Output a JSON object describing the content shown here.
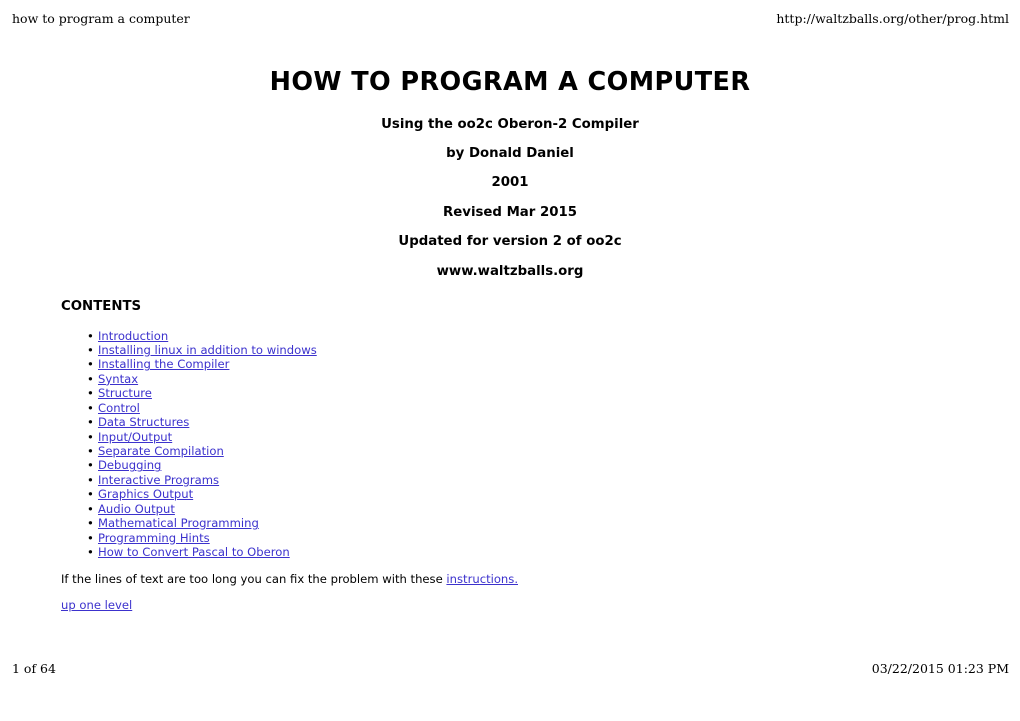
{
  "print_header": {
    "left": "how to program a computer",
    "right": "http://waltzballs.org/other/prog.html"
  },
  "print_footer": {
    "left": "1 of 64",
    "right": "03/22/2015 01:23 PM"
  },
  "document": {
    "title": "HOW TO PROGRAM A COMPUTER",
    "subtitles": [
      "Using the oo2c Oberon-2 Compiler",
      "by Donald Daniel",
      "2001",
      "Revised Mar 2015",
      "Updated for version 2 of oo2c",
      "www.waltzballs.org"
    ],
    "contents_heading": "CONTENTS",
    "toc": [
      "Introduction",
      "Installing linux in addition to windows",
      "Installing the Compiler",
      "Syntax",
      "Structure",
      "Control",
      "Data Structures",
      "Input/Output",
      "Separate Compilation",
      "Debugging",
      "Interactive Programs",
      "Graphics Output",
      "Audio Output",
      "Mathematical Programming",
      "Programming Hints",
      "How to Convert Pascal to Oberon"
    ],
    "note": {
      "text_before": "If the lines of text are too long you can fix the problem with these ",
      "link": "instructions."
    },
    "up_one_level": "up one level"
  },
  "colors": {
    "link": "#3c32cd",
    "text": "#000000",
    "background": "#ffffff"
  }
}
